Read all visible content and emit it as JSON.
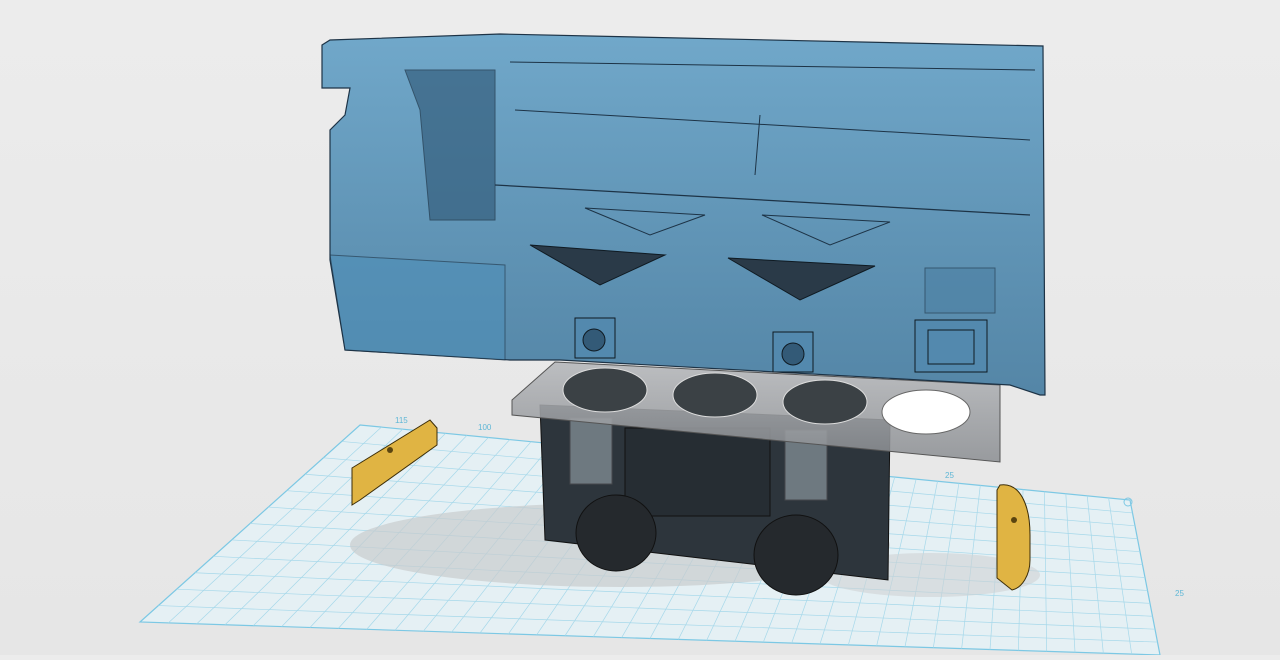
{
  "viewport": {
    "background_color": "#e9e9e9",
    "grid_color": "#7cc8e4",
    "grid_labels": {
      "top_left_a": "115",
      "top_left_b": "100",
      "top_right": "25",
      "right_edge": "25"
    }
  },
  "model": {
    "shell_color": "#3f7ea8",
    "chassis_color": "#2d353c",
    "plate_color": "#8f9296",
    "weight_color": "#e0b443",
    "parts": [
      "body-shell",
      "base-plate",
      "chassis-block",
      "wheel",
      "counterweight"
    ]
  }
}
